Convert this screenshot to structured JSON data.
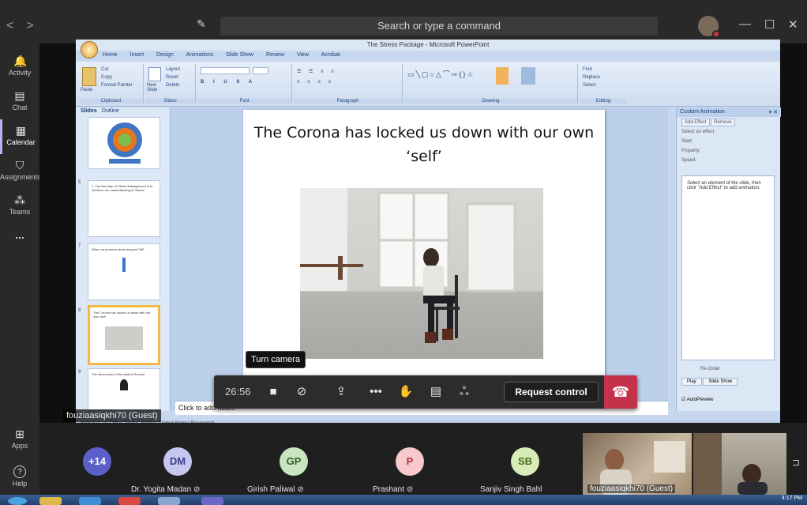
{
  "top_bar": {
    "nav_back": "<",
    "nav_forward": ">",
    "search_placeholder": "Search or type a command",
    "win_minimize": "—",
    "win_maximize": "☐",
    "win_close": "✕"
  },
  "rail": [
    {
      "label": "Activity",
      "icon": "bell-icon",
      "glyph": "🔔"
    },
    {
      "label": "Chat",
      "icon": "chat-icon",
      "glyph": "▤"
    },
    {
      "label": "Calendar",
      "icon": "calendar-icon",
      "glyph": "▦"
    },
    {
      "label": "Assignments",
      "icon": "backpack-icon",
      "glyph": "⛉"
    },
    {
      "label": "Teams",
      "icon": "teams-icon",
      "glyph": "⁂"
    },
    {
      "label": "...",
      "icon": "more-icon",
      "glyph": ""
    },
    {
      "label": "Apps",
      "icon": "apps-icon",
      "glyph": "⊞"
    },
    {
      "label": "Help",
      "icon": "help-icon",
      "glyph": "?"
    }
  ],
  "ppt": {
    "window_title": "The Stress Package - Microsoft PowerPoint",
    "tabs": [
      "Home",
      "Insert",
      "Design",
      "Animations",
      "Slide Show",
      "Review",
      "View",
      "Acrobat"
    ],
    "groups": [
      "Clipboard",
      "Slides",
      "Font",
      "Paragraph",
      "Drawing",
      "Editing"
    ],
    "clipboard_items": [
      "Cut",
      "Copy",
      "Format Painter"
    ],
    "paste_label": "Paste",
    "new_slide_label": "New Slide",
    "slides_items": [
      "Layout",
      "Reset",
      "Delete"
    ],
    "editing_items": [
      "Find",
      "Replace",
      "Select"
    ],
    "pane_tabs": [
      "Slides",
      "Outline"
    ],
    "thumb_texts": [
      "1. The first step of Stress Management is to reinforce our understanding of 'Stress'",
      "When do perceive stress beyond 'ME'",
      "The Corona has locked us down with our own 'self'",
      "The dimensions of the perfect Shower"
    ],
    "thumb_numbers": [
      "5",
      "7",
      "8",
      "9"
    ],
    "slide_title": "The Corona has locked us down with our own ‘self’",
    "notes_placeholder": "Click to add notes",
    "status": "Slide 8 of 14    \"Office Theme\"    English (United States)    Recovered",
    "anim_pane": {
      "title": "Custom Animation",
      "add_effect": "Add Effect",
      "remove": "Remove",
      "modify_label": "Select an effect",
      "start": "Start:",
      "property": "Property:",
      "speed": "Speed:",
      "hint": "Select an element of the slide, then click \"Add Effect\" to add animation.",
      "reorder": "Re-Order",
      "play": "Play",
      "slide_show": "Slide Show",
      "autopreview": "AutoPreview"
    }
  },
  "call": {
    "timer": "26:56",
    "tooltip": "Turn camera on",
    "request_control": "Request control",
    "presenter_name": "fouziaasiqkhi70 (Guest)"
  },
  "participants": [
    {
      "initials": "+14",
      "name": "",
      "color": "#5b5fc7",
      "text_color": "#ffffff"
    },
    {
      "initials": "DM",
      "name": "Dr. Yogita Madan",
      "color": "#c5c7ef",
      "text_color": "#3d3f8f"
    },
    {
      "initials": "GP",
      "name": "Girish Paliwal",
      "color": "#c8e5c0",
      "text_color": "#37632b"
    },
    {
      "initials": "P",
      "name": "Prashant",
      "color": "#f7c8cc",
      "text_color": "#b3323c"
    },
    {
      "initials": "SB",
      "name": "Sanjiv Singh Bahl",
      "color": "#d8ecb8",
      "text_color": "#4d6d1e"
    }
  ],
  "video_tile_name": "fouziaasiqkhi70 (Guest)",
  "taskbar_time": "4:17 PM"
}
